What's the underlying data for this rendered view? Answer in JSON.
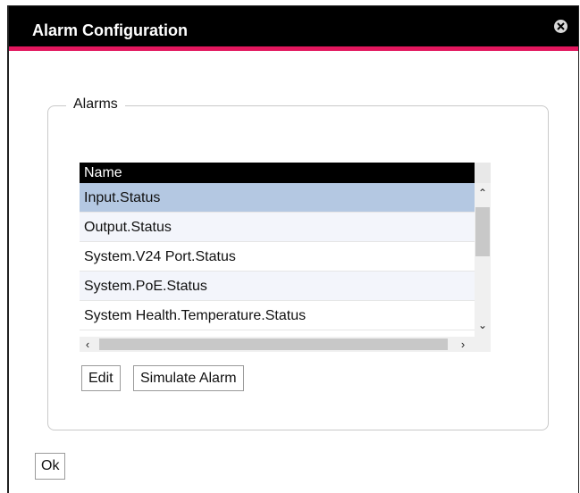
{
  "dialog": {
    "title": "Alarm Configuration",
    "close_icon": "close-circle-icon",
    "accent_color": "#e2175e"
  },
  "alarms": {
    "legend": "Alarms",
    "column_header": "Name",
    "rows": [
      {
        "name": "Input.Status",
        "selected": true
      },
      {
        "name": "Output.Status",
        "selected": false
      },
      {
        "name": "System.V24 Port.Status",
        "selected": false
      },
      {
        "name": "System.PoE.Status",
        "selected": false
      },
      {
        "name": "System Health.Temperature.Status",
        "selected": false
      }
    ],
    "edit_label": "Edit",
    "simulate_label": "Simulate Alarm"
  },
  "footer": {
    "ok_label": "Ok"
  }
}
